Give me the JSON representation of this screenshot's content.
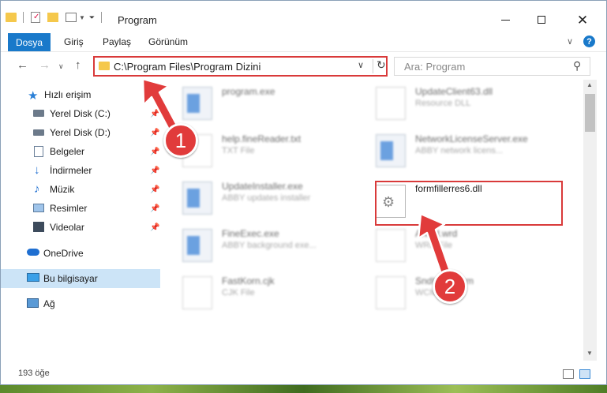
{
  "window": {
    "title": "Program"
  },
  "ribbon": {
    "tabs": [
      "Dosya",
      "Giriş",
      "Paylaş",
      "Görünüm"
    ],
    "help": "?"
  },
  "nav": {
    "back_icon": "←",
    "forward_icon": "→",
    "up_icon": "↑",
    "address": "C:\\Program Files\\Program Dizini",
    "search_placeholder": "Ara: Program"
  },
  "sidebar": {
    "items": [
      {
        "label": "Hızlı erişim",
        "icon": "star-icon"
      },
      {
        "label": "Yerel Disk (C:)",
        "icon": "drive-icon",
        "pinned": true
      },
      {
        "label": "Yerel Disk (D:)",
        "icon": "drive-icon",
        "pinned": true
      },
      {
        "label": "Belgeler",
        "icon": "documents-icon",
        "pinned": true
      },
      {
        "label": "İndirmeler",
        "icon": "download-icon",
        "pinned": true
      },
      {
        "label": "Müzik",
        "icon": "music-icon",
        "pinned": true
      },
      {
        "label": "Resimler",
        "icon": "pictures-icon",
        "pinned": true
      },
      {
        "label": "Videolar",
        "icon": "videos-icon",
        "pinned": true
      },
      {
        "label": "OneDrive",
        "icon": "cloud-icon"
      },
      {
        "label": "Bu bilgisayar",
        "icon": "computer-icon",
        "selected": true
      },
      {
        "label": "Ağ",
        "icon": "network-icon"
      }
    ]
  },
  "files": [
    {
      "name": "program.exe",
      "type": "",
      "icon": "app-icon"
    },
    {
      "name": "UpdateClient63.dll",
      "type": "Resource DLL",
      "icon": "dll-icon"
    },
    {
      "name": "help.fineReader.txt",
      "type": "TXT File",
      "icon": "doc-icon"
    },
    {
      "name": "NetworkLicenseServer.exe",
      "type": "ABBY network licens...",
      "icon": "app-icon"
    },
    {
      "name": "UpdateInstaller.exe",
      "type": "ABBY updates installer",
      "icon": "app-icon"
    },
    {
      "name": "formfillerres6.dll",
      "type": "",
      "icon": "dll-icon",
      "highlighted": true
    },
    {
      "name": "FineExec.exe",
      "type": "ABBY background exe...",
      "icon": "app-icon"
    },
    {
      "name": "Afwrd.wrd",
      "type": "WRD File",
      "icon": "doc-icon"
    },
    {
      "name": "FastKorn.cjk",
      "type": "CJK File",
      "icon": "doc-icon"
    },
    {
      "name": "SndK...6.wcm",
      "type": "WCM File",
      "icon": "doc-icon"
    }
  ],
  "status": {
    "count": "193 öğe"
  },
  "annotations": {
    "badge1": "1",
    "badge2": "2",
    "color": "#e13b3b"
  },
  "colors": {
    "accent": "#1979ca",
    "highlight": "#d93a3a",
    "selected_bg": "#cce4f7"
  }
}
